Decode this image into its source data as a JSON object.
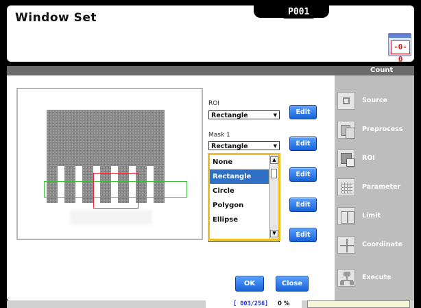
{
  "window": {
    "title": "Window Set",
    "program_id": "P001"
  },
  "header": {
    "band_label": "Count",
    "app_icon_glyph": "-0-0"
  },
  "form": {
    "roi": {
      "label": "ROI",
      "value": "Rectangle",
      "edit_label": "Edit"
    },
    "mask1": {
      "label": "Mask 1",
      "value": "Rectangle",
      "edit_label": "Edit"
    },
    "extra_edit_labels": [
      "Edit",
      "Edit",
      "Edit"
    ],
    "hidden_combo_value": "None"
  },
  "dropdown": {
    "options": [
      "None",
      "Rectangle",
      "Circle",
      "Polygon",
      "Ellipse"
    ],
    "selected": "Rectangle",
    "selected_index": 1
  },
  "buttons": {
    "ok": "OK",
    "close": "Close"
  },
  "sidebar": {
    "items": [
      {
        "label": "Source",
        "icon": "source-icon"
      },
      {
        "label": "Preprocess",
        "icon": "preprocess-icon"
      },
      {
        "label": "ROI",
        "icon": "roi-icon"
      },
      {
        "label": "Parameter",
        "icon": "parameter-icon"
      },
      {
        "label": "Limit",
        "icon": "limit-icon"
      },
      {
        "label": "Coordinate",
        "icon": "coordinate-icon"
      },
      {
        "label": "Execute",
        "icon": "execute-icon"
      }
    ]
  },
  "footer": {
    "status": "[ 003/256]",
    "percent": "0 %"
  },
  "colors": {
    "accent_blue": "#1662d8",
    "selection": "#2f6fc4",
    "dropdown_border": "#f0c020",
    "roi_green": "#3bbf3b",
    "roi_red": "#e22233",
    "status_text": "#1e2fd0"
  }
}
